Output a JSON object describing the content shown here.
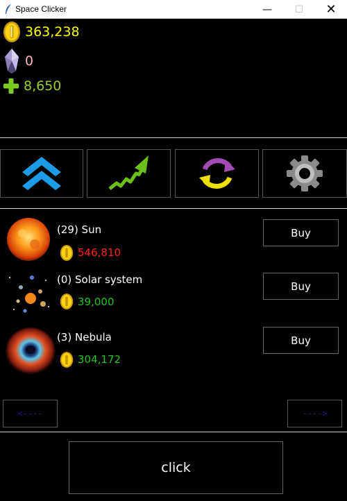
{
  "window": {
    "title": "Space Clicker",
    "minimize": "—",
    "maximize": "☐",
    "close": "✕"
  },
  "stats": {
    "coins": "363,238",
    "gems": "0",
    "per_click": "8,650",
    "colors": {
      "coins": "#ffff00",
      "gems": "#ffb6c1",
      "per_click": "#9acd32"
    }
  },
  "menu": [
    {
      "icon": "upgrade-chevrons-icon"
    },
    {
      "icon": "growth-arrow-icon"
    },
    {
      "icon": "refresh-cycle-icon"
    },
    {
      "icon": "gear-icon"
    }
  ],
  "shop": {
    "items": [
      {
        "name": "(29) Sun",
        "price": "546,810",
        "price_color": "#ff2020",
        "buy_label": "Buy",
        "image": "sun-image"
      },
      {
        "name": "(0) Solar system",
        "price": "39,000",
        "price_color": "#22c322",
        "buy_label": "Buy",
        "image": "solar-system-image"
      },
      {
        "name": "(3) Nebula",
        "price": "304,172",
        "price_color": "#22c322",
        "buy_label": "Buy",
        "image": "nebula-image"
      }
    ],
    "prev_label": "<----",
    "next_label": "---->"
  },
  "click_label": "click"
}
